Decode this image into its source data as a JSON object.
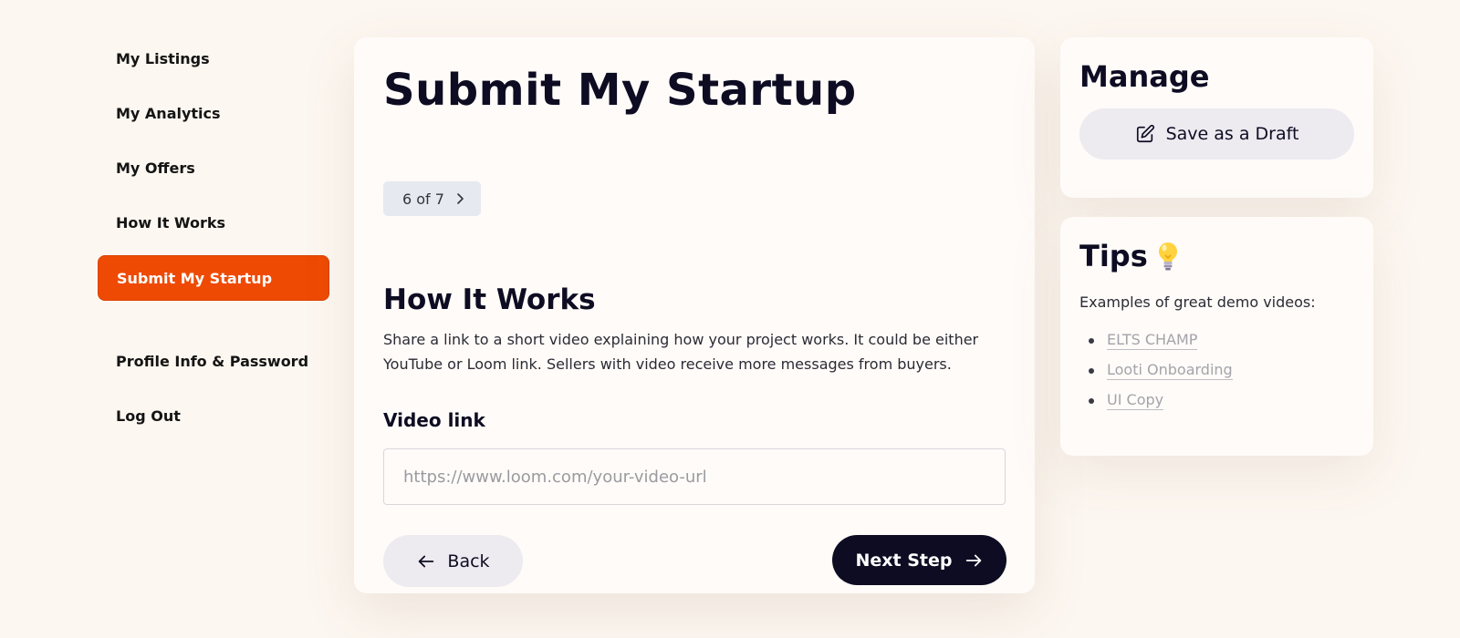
{
  "sidebar": {
    "items": [
      {
        "label": "My Listings"
      },
      {
        "label": "My Analytics"
      },
      {
        "label": "My Offers"
      },
      {
        "label": "How It Works"
      },
      {
        "label": "Submit My Startup",
        "active": true
      }
    ],
    "account_items": [
      {
        "label": "Profile Info & Password"
      },
      {
        "label": "Log Out"
      }
    ]
  },
  "main": {
    "title": "Submit My Startup",
    "step": "6 of 7",
    "section_title": "How It Works",
    "section_description": "Share a link to a short video explaining how your project works. It could be either YouTube or Loom link. Sellers with video receive more messages from buyers.",
    "field_label": "Video link",
    "video_input": {
      "value": "",
      "placeholder": "https://www.loom.com/your-video-url"
    },
    "back_label": "Back",
    "next_label": "Next Step"
  },
  "manage": {
    "title": "Manage",
    "draft_label": "Save as a Draft"
  },
  "tips": {
    "title": "Tips",
    "intro": "Examples of great demo videos:",
    "links": [
      "ELTS CHAMP",
      "Looti Onboarding",
      "UI Copy"
    ]
  },
  "colors": {
    "accent": "#ef4a03",
    "dark": "#0d0c22",
    "background": "#fdf7f1",
    "card": "#fffbf8",
    "pill": "#edeaf0"
  },
  "icons": {
    "step_pill": "chevron-right-icon",
    "back": "arrow-left-icon",
    "next": "arrow-right-icon",
    "draft": "edit-icon",
    "tips": "lightbulb-icon"
  }
}
